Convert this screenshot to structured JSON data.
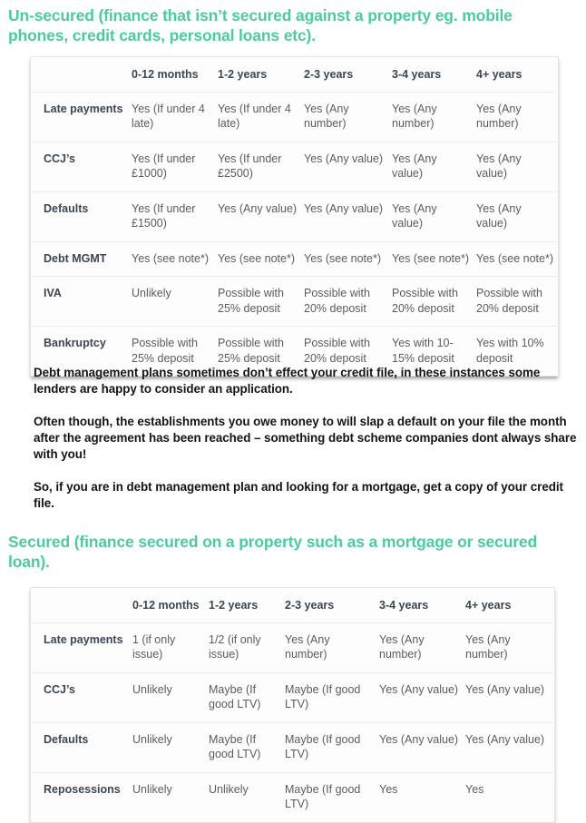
{
  "theme": {
    "heading_color": "#4ecaa0",
    "body_text_color": "#141414",
    "table_label_color": "#3c4654",
    "table_cell_color": "#5c5c5c",
    "table_border_color": "#e4e4e4",
    "page_background": "#ffffff"
  },
  "headings": {
    "unsecured": "Un-secured (finance that isn’t secured against a property eg. mobile phones, credit cards, personal loans etc).",
    "secured": "Secured (finance secured on a property such as a mortgage or secured loan)."
  },
  "paragraphs": {
    "p1": "Debt management plans sometimes don’t effect your credit file, in these instances some lenders are happy to consider an application.",
    "p2": "Often though, the establishments you owe money to will slap a default on your file the month after the agreement has been reached – something debt scheme companies dont always share with you!",
    "p3": "So, if you are in debt management plan and looking for a mortgage, get a copy of your credit file."
  },
  "tables": {
    "unsecured": {
      "corner_label": "",
      "columns": [
        "0-12 months",
        "1-2 years",
        "2-3 years",
        "3-4 years",
        "4+ years"
      ],
      "rows": [
        {
          "label": "Late payments",
          "cells": [
            "Yes (If under 4 late)",
            "Yes (If under 4 late)",
            "Yes (Any number)",
            "Yes (Any number)",
            "Yes (Any number)"
          ]
        },
        {
          "label": "CCJ’s",
          "cells": [
            "Yes (If under £1000)",
            "Yes (If under £2500)",
            "Yes (Any value)",
            "Yes (Any value)",
            "Yes (Any value)"
          ]
        },
        {
          "label": "Defaults",
          "cells": [
            "Yes (If under £1500)",
            "Yes (Any value)",
            "Yes (Any value)",
            "Yes (Any value)",
            "Yes (Any value)"
          ]
        },
        {
          "label": "Debt MGMT",
          "cells": [
            "Yes (see note*)",
            "Yes (see note*)",
            "Yes (see note*)",
            "Yes (see note*)",
            "Yes (see note*)"
          ]
        },
        {
          "label": "IVA",
          "cells": [
            "Unlikely",
            "Possible with 25% deposit",
            "Possible with 20% deposit",
            "Possible with 20% deposit",
            "Possible with 20% deposit"
          ]
        },
        {
          "label": "Bankruptcy",
          "cells": [
            "Possible with 25% deposit",
            "Possible with 25% deposit",
            "Possible with 20% deposit",
            "Yes with 10-15% deposit",
            "Yes with 10% deposit"
          ]
        }
      ]
    },
    "secured": {
      "corner_label": "",
      "columns": [
        "0-12 months",
        "1-2 years",
        "2-3 years",
        "3-4 years",
        "4+ years"
      ],
      "rows": [
        {
          "label": "Late payments",
          "cells": [
            "1 (if only issue)",
            "1/2 (if only issue)",
            "Yes (Any number)",
            "Yes (Any number)",
            "Yes (Any number)"
          ]
        },
        {
          "label": "CCJ’s",
          "cells": [
            "Unlikely",
            "Maybe (If good LTV)",
            "Maybe (If good LTV)",
            "Yes (Any value)",
            "Yes (Any value)"
          ]
        },
        {
          "label": "Defaults",
          "cells": [
            "Unlikely",
            "Maybe (If good LTV)",
            "Maybe (If good LTV)",
            "Yes (Any value)",
            "Yes (Any value)"
          ]
        },
        {
          "label": "Reposessions",
          "cells": [
            "Unlikely",
            "Unlikely",
            "Maybe (If good LTV)",
            "Yes",
            "Yes"
          ]
        }
      ]
    }
  }
}
